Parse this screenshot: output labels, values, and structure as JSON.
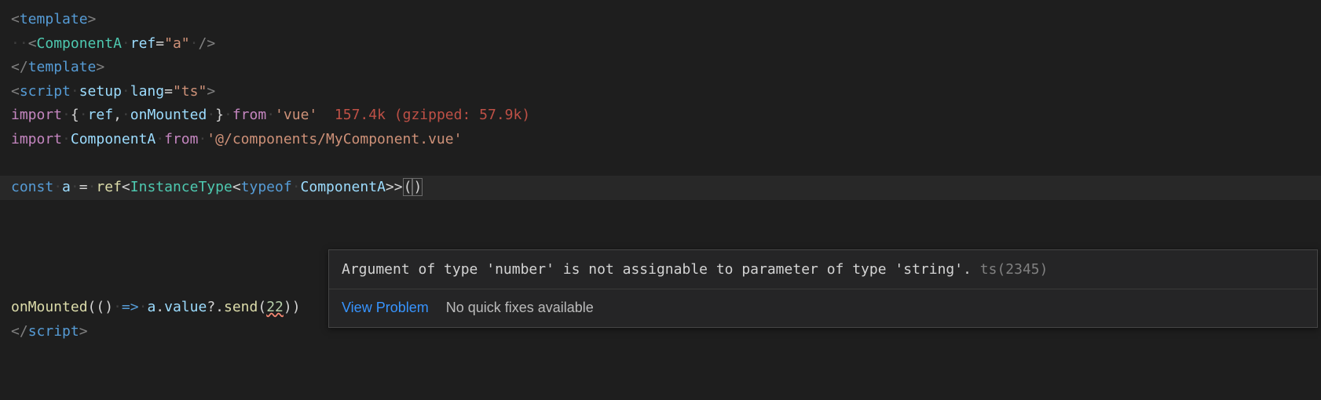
{
  "code": {
    "line1": {
      "open_bracket": "<",
      "tag": "template",
      "close_bracket": ">"
    },
    "line2": {
      "indent_dots": "··",
      "open_bracket": "<",
      "tag": "ComponentA",
      "ws1": "·",
      "attr": "ref",
      "eq": "=",
      "quote1": "\"",
      "value": "a",
      "quote2": "\"",
      "ws2": "·",
      "close": "/>"
    },
    "line3": {
      "open": "</",
      "tag": "template",
      "close": ">"
    },
    "line4": {
      "open": "<",
      "tag": "script",
      "ws1": "·",
      "attr1": "setup",
      "ws2": "·",
      "attr2": "lang",
      "eq": "=",
      "q1": "\"",
      "val": "ts",
      "q2": "\"",
      "close": ">"
    },
    "line5": {
      "import": "import",
      "ws1": "·",
      "brace1": "{",
      "ws2": "·",
      "id1": "ref",
      "comma": ",",
      "ws3": "·",
      "id2": "onMounted",
      "ws4": "·",
      "brace2": "}",
      "ws5": "·",
      "from": "from",
      "ws6": "·",
      "q1": "'",
      "mod": "vue",
      "q2": "'",
      "size": "  157.4k (gzipped: 57.9k)"
    },
    "line6": {
      "import": "import",
      "ws1": "·",
      "id": "ComponentA",
      "ws2": "·",
      "from": "from",
      "ws3": "·",
      "q1": "'",
      "mod": "@/components/MyComponent.vue",
      "q2": "'"
    },
    "line8": {
      "const": "const",
      "ws1": "·",
      "id": "a",
      "ws2": "·",
      "eq": "=",
      "ws3": "·",
      "fn": "ref",
      "lt": "<",
      "type1": "InstanceType",
      "lt2": "<",
      "typeof": "typeof",
      "ws4": "·",
      "compA": "ComponentA",
      "gt2": ">>",
      "paren_open": "(",
      "paren_close": ")"
    },
    "line13": {
      "fn": "onMounted",
      "paren1": "(()",
      "ws1": "·",
      "arrow": "=>",
      "ws2": "·",
      "id": "a",
      "dot1": ".",
      "prop1": "value",
      "opt": "?.",
      "method": "send",
      "paren2": "(",
      "arg": "22",
      "paren3": "))"
    },
    "line14": {
      "open": "</",
      "tag": "script",
      "close": ">"
    }
  },
  "tooltip": {
    "message": "Argument of type 'number' is not assignable to parameter of type 'string'.",
    "errcode": " ts(2345)",
    "view_problem": "View Problem",
    "no_fixes": "No quick fixes available"
  }
}
